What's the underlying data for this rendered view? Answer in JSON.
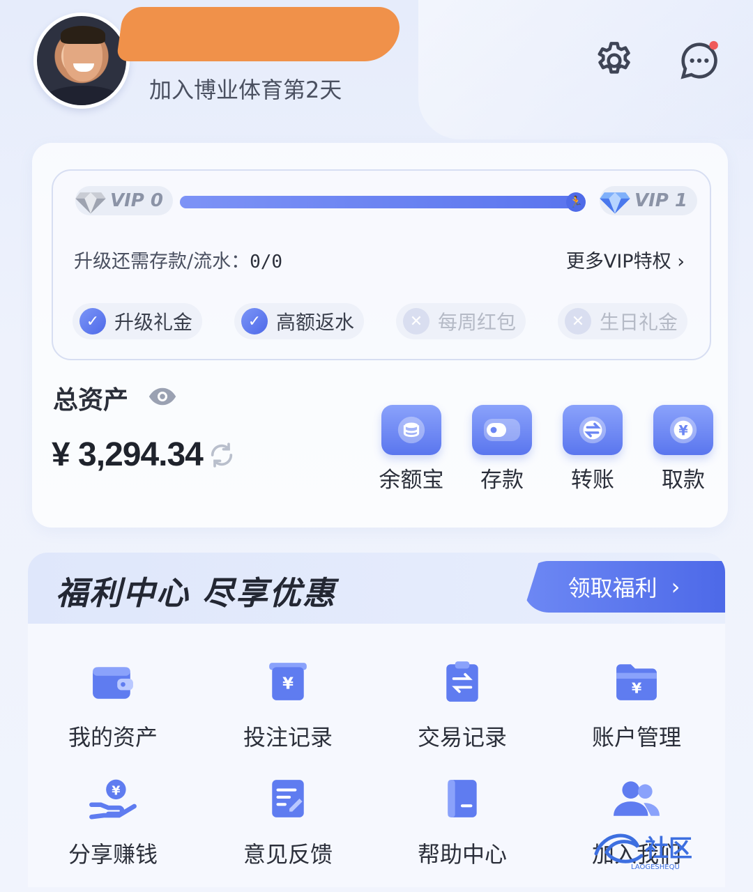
{
  "header": {
    "join_days": "加入博业体育第2天"
  },
  "vip": {
    "current_level": "VIP 0",
    "next_level": "VIP 1",
    "progress": 1.0,
    "upgrade_label": "升级还需存款/流水：",
    "upgrade_value": "0/0",
    "more_link": "更多VIP特权",
    "perks": [
      {
        "label": "升级礼金",
        "enabled": true
      },
      {
        "label": "高额返水",
        "enabled": true
      },
      {
        "label": "每周红包",
        "enabled": false
      },
      {
        "label": "生日礼金",
        "enabled": false
      }
    ]
  },
  "assets": {
    "label": "总资产",
    "value": "¥ 3,294.34"
  },
  "actions": [
    {
      "label": "余额宝",
      "icon": "coins-icon"
    },
    {
      "label": "存款",
      "icon": "deposit-icon"
    },
    {
      "label": "转账",
      "icon": "transfer-icon"
    },
    {
      "label": "取款",
      "icon": "withdraw-icon"
    }
  ],
  "welfare": {
    "title": "福利中心  尽享优惠",
    "button": "领取福利",
    "items": [
      {
        "label": "我的资产",
        "icon": "wallet-icon"
      },
      {
        "label": "投注记录",
        "icon": "bet-record-icon"
      },
      {
        "label": "交易记录",
        "icon": "transaction-icon"
      },
      {
        "label": "账户管理",
        "icon": "folder-icon"
      },
      {
        "label": "分享赚钱",
        "icon": "share-money-icon"
      },
      {
        "label": "意见反馈",
        "icon": "feedback-icon"
      },
      {
        "label": "帮助中心",
        "icon": "help-book-icon"
      },
      {
        "label": "加入我们",
        "icon": "users-icon"
      }
    ]
  },
  "colors": {
    "accent": "#5a75ee",
    "notification_dot": "#ef5a5a",
    "redaction": "#f0914a"
  }
}
